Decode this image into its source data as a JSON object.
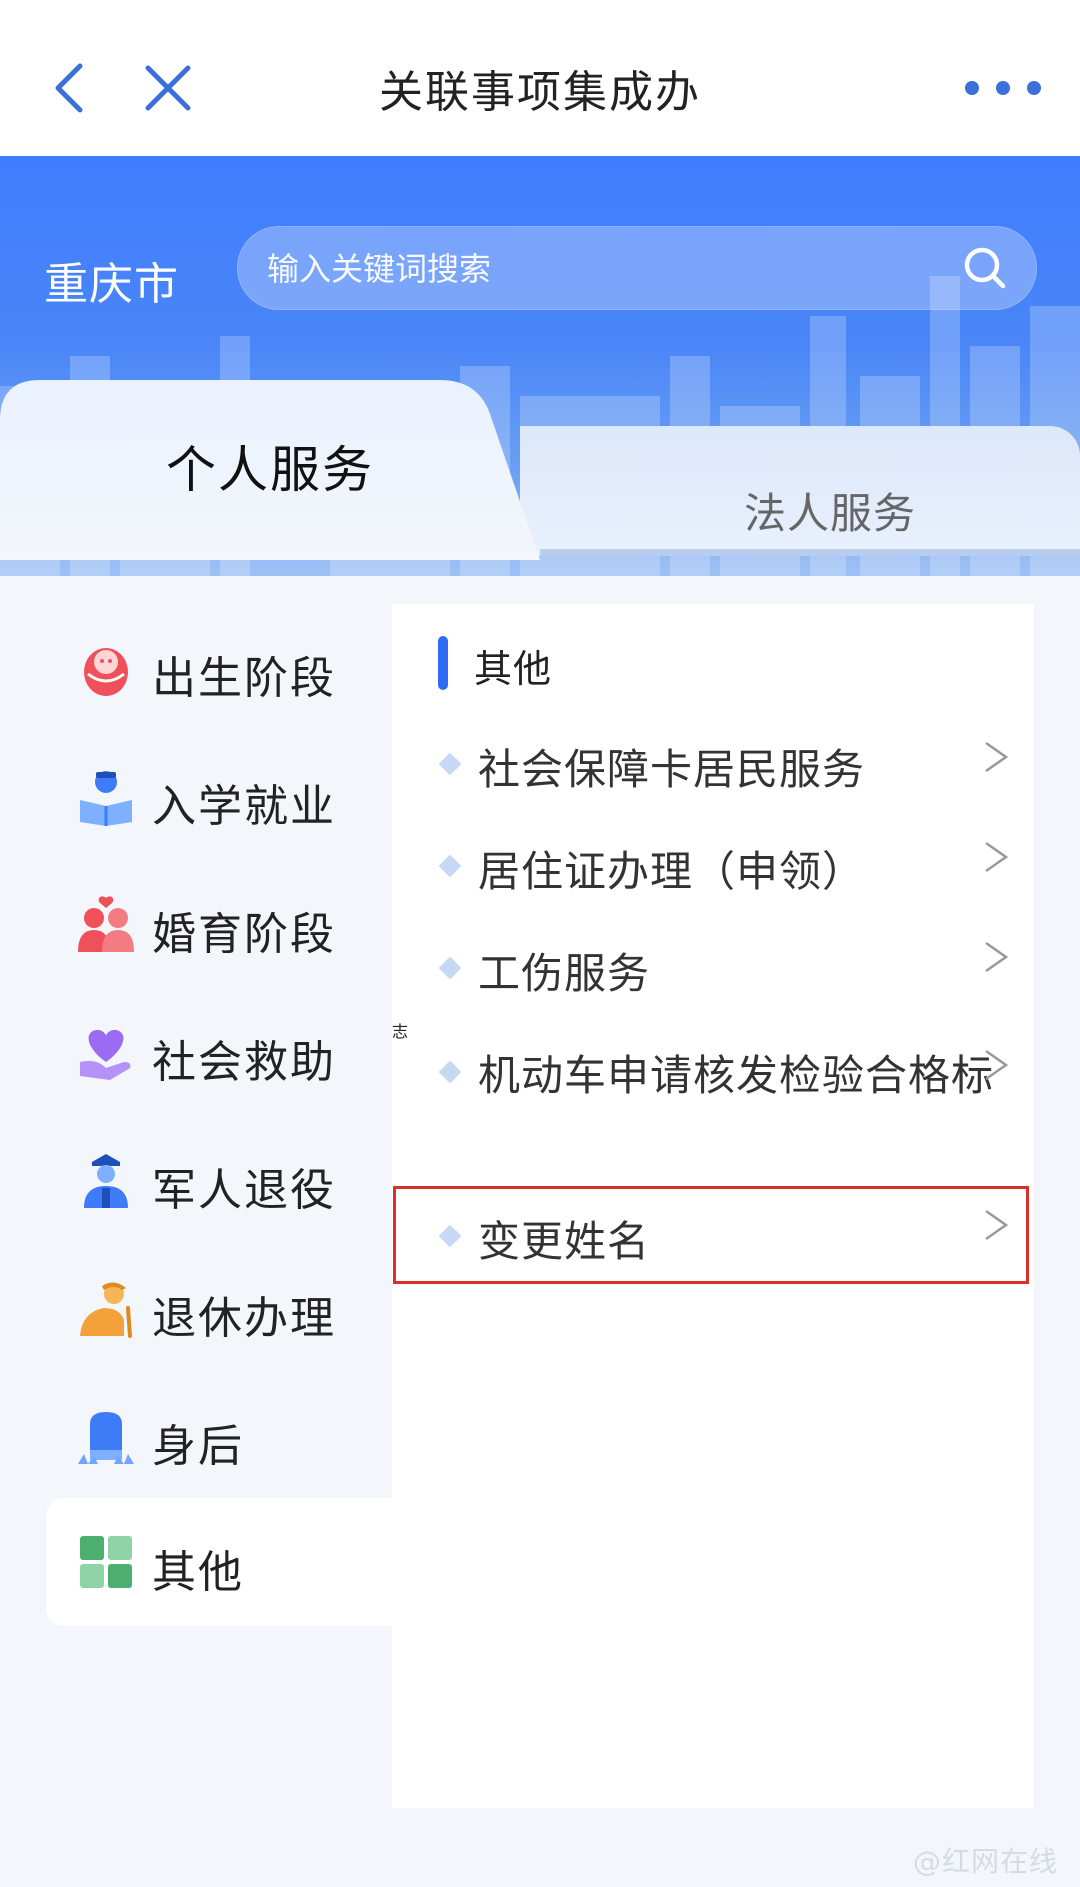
{
  "topbar": {
    "title": "关联事项集成办",
    "back_icon": "chevron-left-icon",
    "close_icon": "close-icon",
    "more_icon": "more-dots-icon"
  },
  "header": {
    "city": "重庆市",
    "search_placeholder": "输入关键词搜索"
  },
  "tabs": {
    "personal": "个人服务",
    "legal": "法人服务",
    "active": "personal"
  },
  "categories": [
    {
      "label": "出生阶段",
      "icon": "baby-icon",
      "color": "#f0505a"
    },
    {
      "label": "入学就业",
      "icon": "student-reading-icon",
      "color": "#3e7bf6"
    },
    {
      "label": "婚育阶段",
      "icon": "couple-icon",
      "color": "#f0505a"
    },
    {
      "label": "社会救助",
      "icon": "heart-hand-icon",
      "color": "#8a5cf0"
    },
    {
      "label": "军人退役",
      "icon": "soldier-icon",
      "color": "#3e7bf6"
    },
    {
      "label": "退休办理",
      "icon": "elder-icon",
      "color": "#f3a13a"
    },
    {
      "label": "身后",
      "icon": "memorial-icon",
      "color": "#3e7bf6"
    },
    {
      "label": "其他",
      "icon": "grid-icon",
      "color": "#4caf6f"
    }
  ],
  "active_category": "其他",
  "panel": {
    "section_title": "其他",
    "items": [
      {
        "label": "社会保障卡居民服务"
      },
      {
        "label": "居住证办理（申领）"
      },
      {
        "label": "工伤服务"
      },
      {
        "label": "机动车申请核发检验合格标",
        "label_line2": "志"
      },
      {
        "label": "变更姓名",
        "highlighted": true
      }
    ]
  },
  "watermark": "@红网在线",
  "colors": {
    "brand_blue": "#3f7dff",
    "highlight_red": "#d9302c",
    "section_bar": "#2f6cf6"
  }
}
